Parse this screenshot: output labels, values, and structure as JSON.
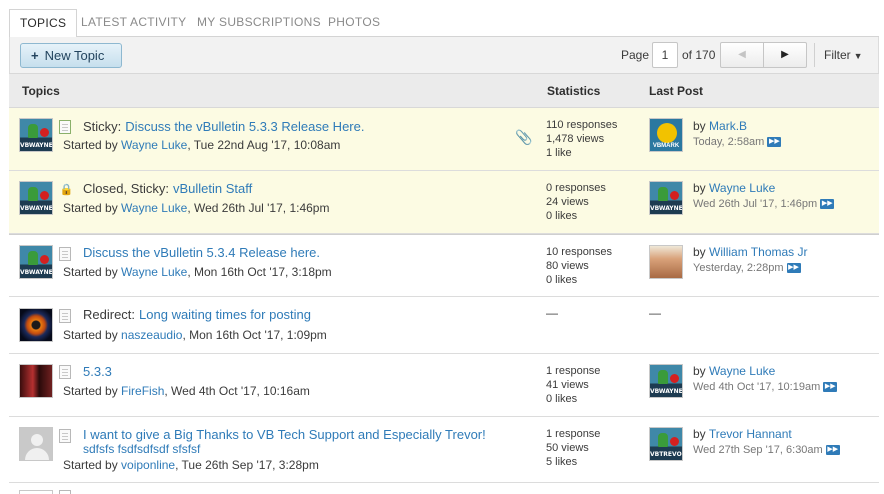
{
  "tabs": [
    {
      "label": "TOPICS",
      "active": true
    },
    {
      "label": "LATEST ACTIVITY",
      "active": false
    },
    {
      "label": "MY SUBSCRIPTIONS",
      "active": false
    },
    {
      "label": "PHOTOS",
      "active": false
    }
  ],
  "toolbar": {
    "new_topic_label": "New Topic",
    "page_label": "Page",
    "page_value": "1",
    "page_total": "of 170",
    "filter_label": "Filter"
  },
  "columns": {
    "topics": "Topics",
    "statistics": "Statistics",
    "last_post": "Last Post"
  },
  "topics": [
    {
      "sticky": true,
      "status_icon": "new-doc-icon",
      "avatar": "wayne-avatar",
      "prefix": "Sticky:",
      "title": "Discuss the vBulletin 5.3.3 Release Here.",
      "started_pre": "Started by",
      "author": "Wayne Luke",
      "started_date": ", Tue 22nd Aug '17, 10:08am",
      "has_attachment": true,
      "stats": [
        "110 responses",
        "1,478 views",
        "1 like"
      ],
      "last_by_pre": "by",
      "last_by": "Mark.B",
      "last_date": "Today, 2:58am",
      "last_avatar": "mark-avatar"
    },
    {
      "sticky": true,
      "status_icon": "lock-icon",
      "avatar": "wayne-avatar",
      "prefix": "Closed, Sticky:",
      "title": "vBulletin Staff",
      "started_pre": "Started by",
      "author": "Wayne Luke",
      "started_date": ", Wed 26th Jul '17, 1:46pm",
      "stats": [
        "0 responses",
        "24 views",
        "0 likes"
      ],
      "last_by_pre": "by",
      "last_by": "Wayne Luke",
      "last_date": "Wed 26th Jul '17, 1:46pm",
      "last_avatar": "wayne-avatar"
    },
    {
      "sticky": false,
      "status_icon": "doc-icon",
      "avatar": "wayne-avatar",
      "prefix": "",
      "title": "Discuss the vBulletin 5.3.4 Release here.",
      "started_pre": "Started by",
      "author": "Wayne Luke",
      "started_date": ", Mon 16th Oct '17, 3:18pm",
      "stats": [
        "10 responses",
        "80 views",
        "0 likes"
      ],
      "last_by_pre": "by",
      "last_by": "William Thomas Jr",
      "last_date": "Yesterday, 2:28pm",
      "last_avatar": "person-avatar"
    },
    {
      "sticky": false,
      "status_icon": "doc-icon",
      "avatar": "eye-avatar",
      "prefix": "Redirect:",
      "title": "Long waiting times for posting",
      "started_pre": "Started by",
      "author": "naszeaudio",
      "started_date": ", Mon 16th Oct '17, 1:09pm",
      "stats_dash": "—",
      "last_dash": "—"
    },
    {
      "sticky": false,
      "status_icon": "doc-icon",
      "avatar": "couple-avatar",
      "prefix": "",
      "title": "5.3.3",
      "started_pre": "Started by",
      "author": "FireFish",
      "started_date": ", Wed 4th Oct '17, 10:16am",
      "stats": [
        "1 response",
        "41 views",
        "0 likes"
      ],
      "last_by_pre": "by",
      "last_by": "Wayne Luke",
      "last_date": "Wed 4th Oct '17, 10:19am",
      "last_avatar": "wayne-avatar"
    },
    {
      "sticky": false,
      "status_icon": "doc-icon",
      "avatar": "gray-avatar",
      "prefix": "",
      "title": "I want to give a Big Thanks to VB Tech Support and Especially Trevor!",
      "subtitle": "sdfsfs fsdfsdfsdf sfsfsf",
      "started_pre": "Started by",
      "author": "voiponline",
      "started_date": ", Tue 26th Sep '17, 3:28pm",
      "stats": [
        "1 response",
        "50 views",
        "5 likes"
      ],
      "last_by_pre": "by",
      "last_by": "Trevor Hannant",
      "last_date": "Wed 27th Sep '17, 6:30am",
      "last_avatar": "trevor-avatar"
    }
  ],
  "avatar_tags": {
    "wayne": "VBWAYNE",
    "mark": "VBMARK",
    "trevor": "VBTREVOR"
  }
}
